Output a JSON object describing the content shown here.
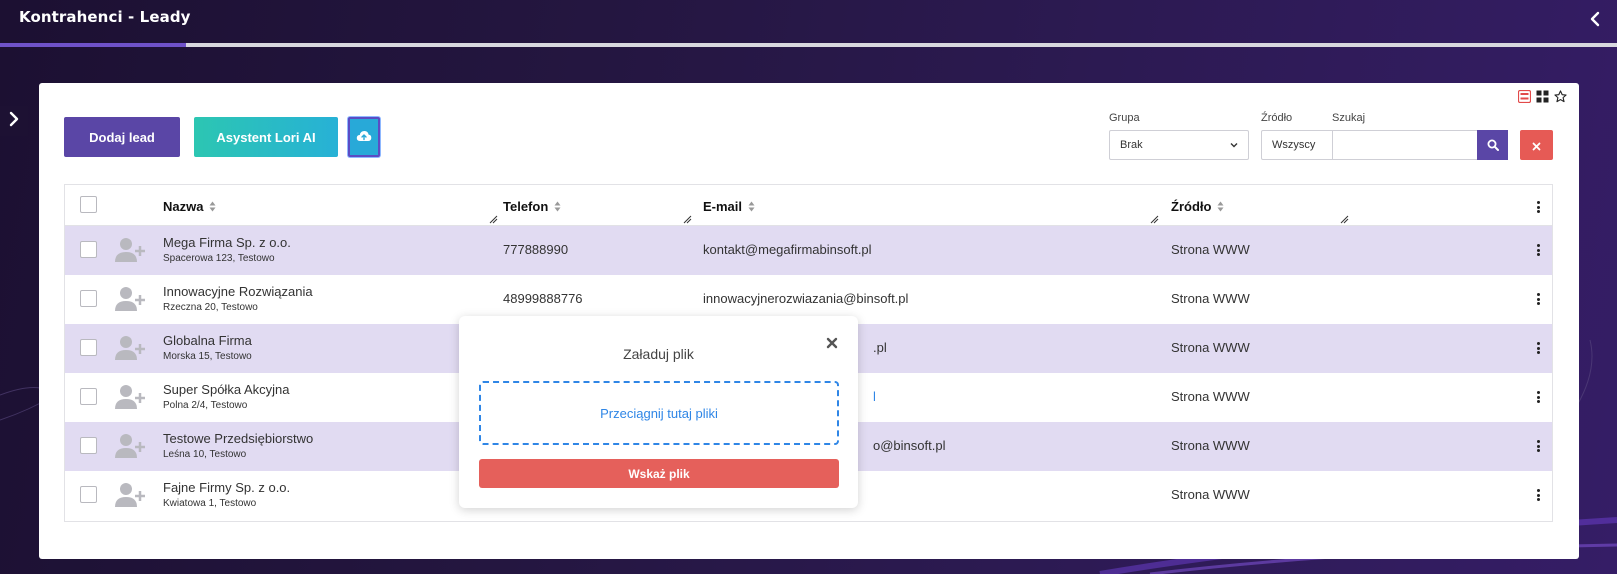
{
  "header": {
    "title": "Kontrahenci - Leady",
    "progress": 0.115
  },
  "toolbar": {
    "add_label": "Dodaj lead",
    "ai_label": "Asystent Lori AI",
    "upload_icon": "cloud-upload-icon"
  },
  "filters": {
    "group_label": "Grupa",
    "group_value": "Brak",
    "source_label": "Źródło",
    "source_value": "Wszyscy",
    "search_label": "Szukaj",
    "search_value": ""
  },
  "table": {
    "columns": {
      "name": "Nazwa",
      "phone": "Telefon",
      "email": "E-mail",
      "source": "Źródło"
    },
    "rows": [
      {
        "name": "Mega Firma Sp. z o.o.",
        "address": "Spacerowa 123, Testowo",
        "phone": "777888990",
        "email": "kontakt@megafirmabinsoft.pl",
        "source": "Strona WWW"
      },
      {
        "name": "Innowacyjne Rozwiązania",
        "address": "Rzeczna 20, Testowo",
        "phone": "48999888776",
        "email": "innowacyjnerozwiazania@binsoft.pl",
        "source": "Strona WWW"
      },
      {
        "name": "Globalna Firma",
        "address": "Morska 15, Testowo",
        "phone": "",
        "email": ".pl",
        "source": "Strona WWW"
      },
      {
        "name": "Super Spółka Akcyjna",
        "address": "Polna 2/4, Testowo",
        "phone": "",
        "email": "l",
        "source": "Strona WWW"
      },
      {
        "name": "Testowe Przedsiębiorstwo",
        "address": "Leśna 10, Testowo",
        "phone": "",
        "email": "o@binsoft.pl",
        "source": "Strona WWW"
      },
      {
        "name": "Fajne Firmy Sp. z o.o.",
        "address": "Kwiatowa 1, Testowo",
        "phone": "",
        "email": "",
        "source": "Strona WWW"
      }
    ]
  },
  "modal": {
    "title": "Załaduj plik",
    "dropzone_text": "Przeciągnij tutaj pliki",
    "button_label": "Wskaż plik"
  },
  "colors": {
    "primary": "#5a46a6",
    "teal": "#2cc6b2",
    "danger": "#e65a55",
    "row_alt": "#e1dbf2",
    "link": "#2f86e6"
  }
}
